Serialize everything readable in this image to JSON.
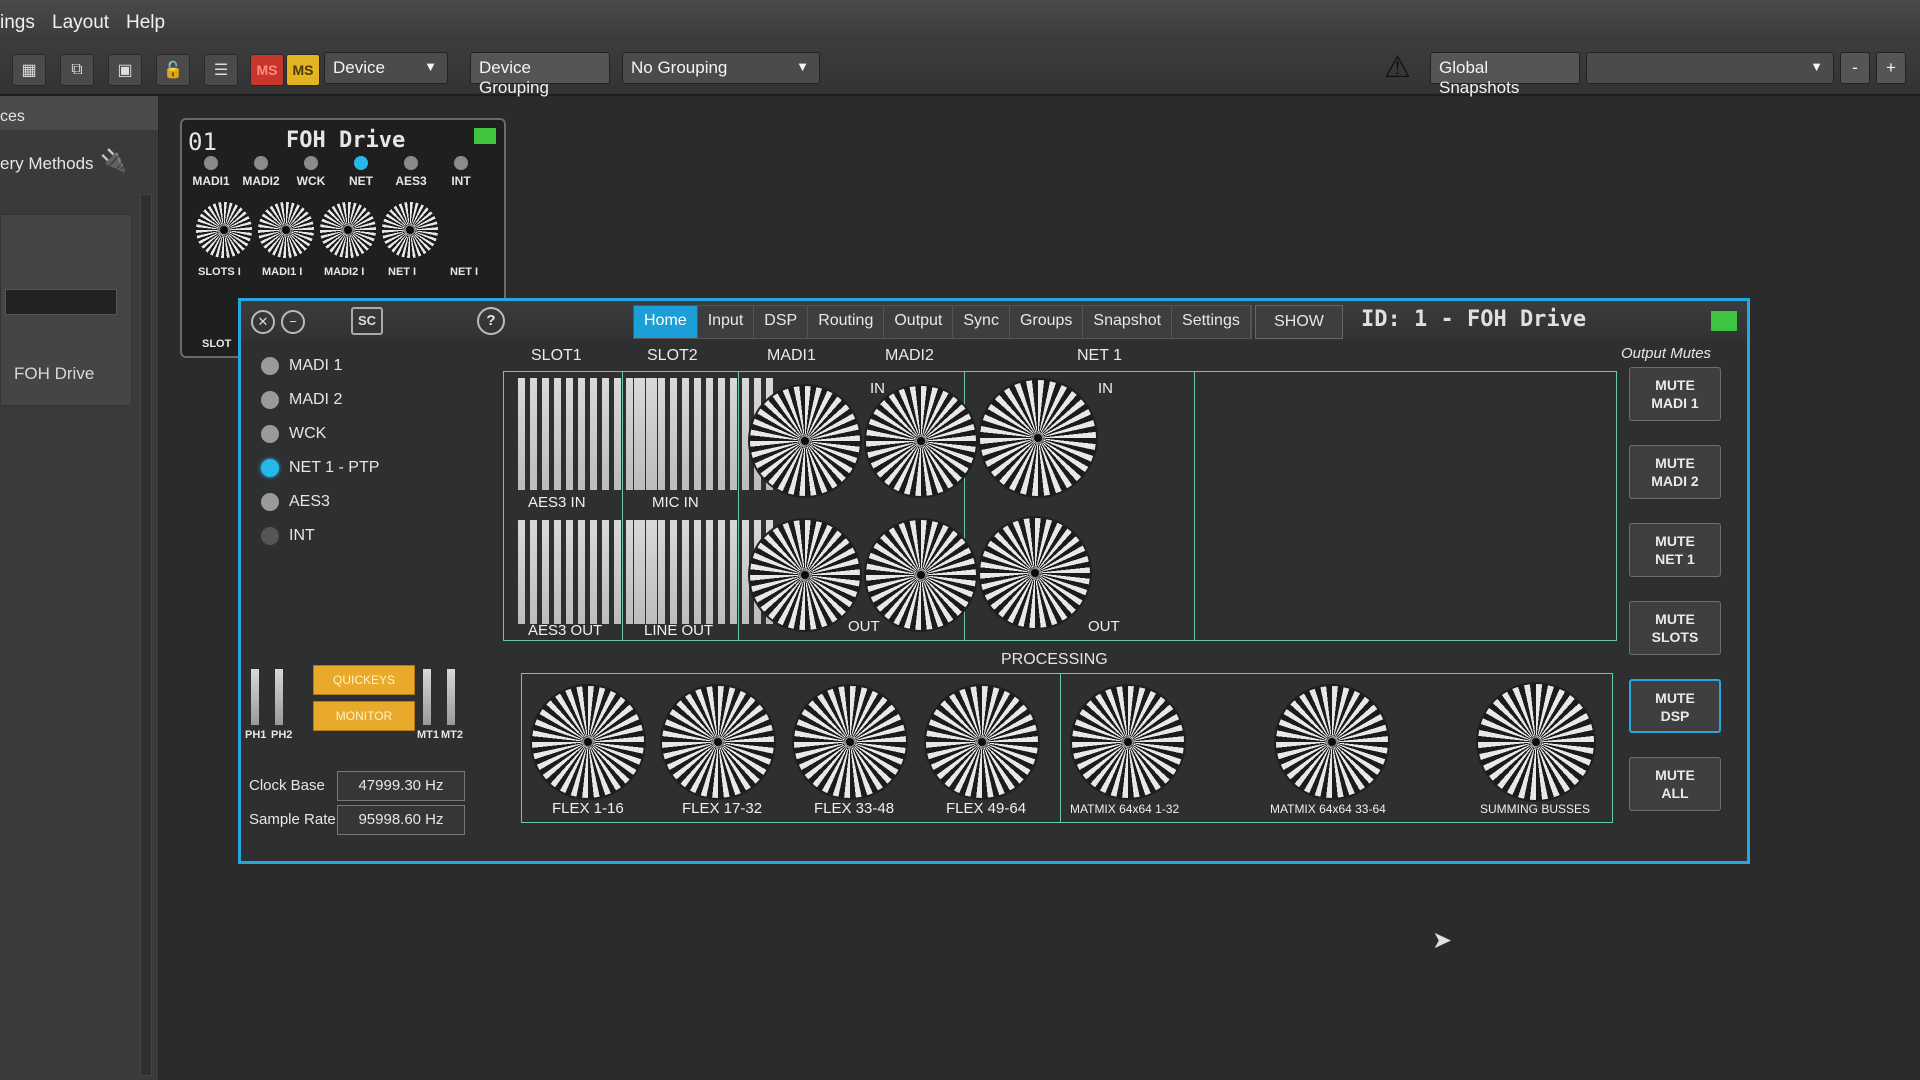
{
  "menu": [
    "ings",
    "Layout",
    "Help"
  ],
  "toolbar": {
    "ms1": "MS",
    "ms2": "MS",
    "device_drop": "Device",
    "device_grouping": "Device Grouping",
    "grouping_drop": "No Grouping",
    "global_snapshots": "Global Snapshots",
    "snapshot_drop": "",
    "minus": "-",
    "plus": "+"
  },
  "sidebar": {
    "header": "ces",
    "methods": "ery Methods",
    "device_label": "FOH Drive"
  },
  "mini_card": {
    "number": "01",
    "title": "FOH Drive",
    "sources": [
      {
        "label": "MADI1",
        "active": false
      },
      {
        "label": "MADI2",
        "active": false
      },
      {
        "label": "WCK",
        "active": false
      },
      {
        "label": "NET",
        "active": true
      },
      {
        "label": "AES3",
        "active": false
      },
      {
        "label": "INT",
        "active": false
      }
    ],
    "knob_labels": [
      "SLOTS I",
      "MADI1 I",
      "MADI2 I",
      "NET I",
      "NET I"
    ],
    "partial_label": "SLOT"
  },
  "panel": {
    "sc": "SC",
    "help": "?",
    "tabs": [
      "Home",
      "Input",
      "DSP",
      "Routing",
      "Output",
      "Sync",
      "Groups",
      "Snapshot",
      "Settings"
    ],
    "active_tab": "Home",
    "show": "SHOW",
    "id_title": "ID: 1 - FOH Drive",
    "sync_sources": [
      {
        "label": "MADI 1",
        "state": "off"
      },
      {
        "label": "MADI 2",
        "state": "off"
      },
      {
        "label": "WCK",
        "state": "off"
      },
      {
        "label": "NET 1 - PTP",
        "state": "on"
      },
      {
        "label": "AES3",
        "state": "off"
      },
      {
        "label": "INT",
        "state": "dim"
      }
    ],
    "columns": [
      "SLOT1",
      "SLOT2",
      "MADI1",
      "MADI2",
      "NET 1"
    ],
    "io_labels": {
      "aes3_in": "AES3 IN",
      "mic_in": "MIC IN",
      "aes3_out": "AES3 OUT",
      "line_out": "LINE OUT",
      "in": "IN",
      "out": "OUT"
    },
    "processing_title": "PROCESSING",
    "processing": [
      "FLEX 1-16",
      "FLEX 17-32",
      "FLEX 33-48",
      "FLEX 49-64",
      "MATMIX 64x64 1-32",
      "MATMIX 64x64 33-64",
      "SUMMING BUSSES"
    ],
    "output_mutes_title": "Output Mutes",
    "mutes": [
      {
        "line1": "MUTE",
        "line2": "MADI 1",
        "active": false
      },
      {
        "line1": "MUTE",
        "line2": "MADI 2",
        "active": false
      },
      {
        "line1": "MUTE",
        "line2": "NET 1",
        "active": false
      },
      {
        "line1": "MUTE",
        "line2": "SLOTS",
        "active": false
      },
      {
        "line1": "MUTE",
        "line2": "DSP",
        "active": true
      },
      {
        "line1": "MUTE",
        "line2": "ALL",
        "active": false
      }
    ],
    "quickeys": "QUICKEYS",
    "monitor": "MONITOR",
    "meters": [
      "PH1",
      "PH2",
      "MT1",
      "MT2"
    ],
    "clock_base_label": "Clock Base",
    "clock_base_value": "47999.30 Hz",
    "sample_rate_label": "Sample Rate",
    "sample_rate_value": "95998.60 Hz"
  },
  "colors": {
    "accent": "#1c9fd8",
    "grid_line": "#67c9a8",
    "led_green": "#3ec43e",
    "quickeys": "#e9a92b"
  }
}
